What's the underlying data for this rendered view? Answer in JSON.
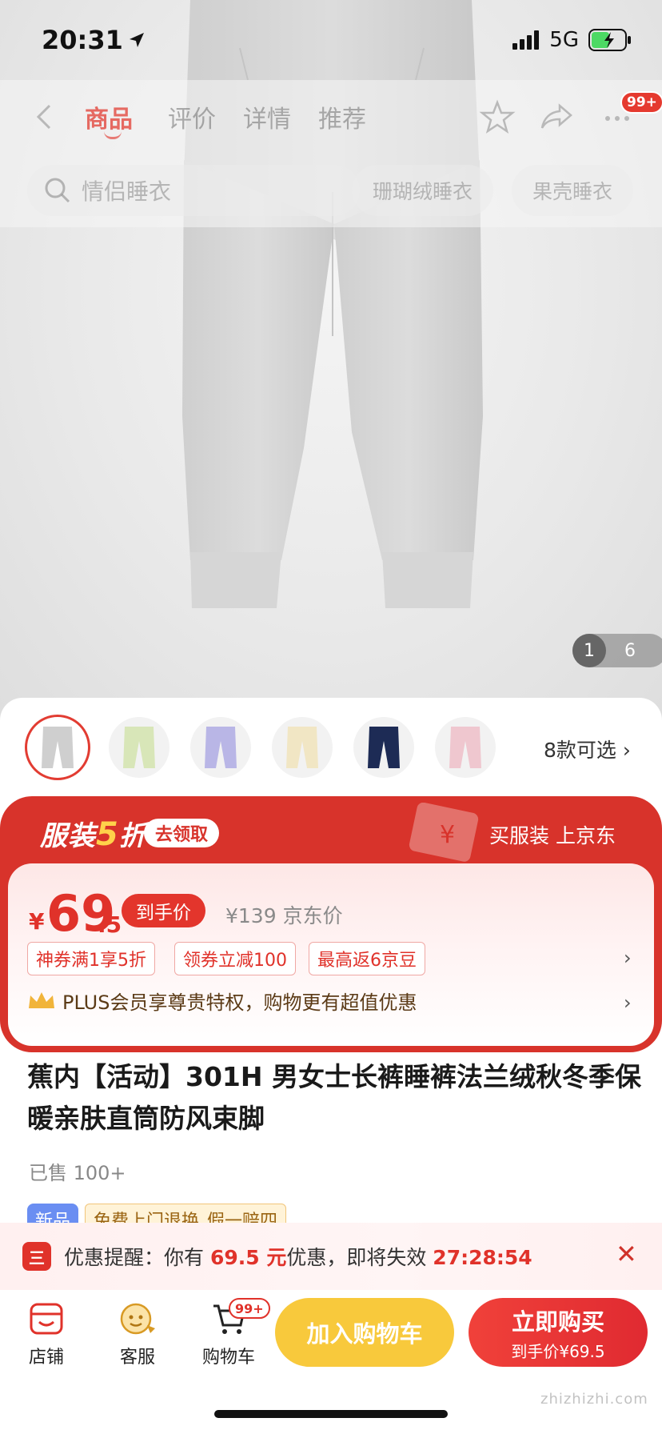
{
  "status": {
    "time": "20:31",
    "network": "5G"
  },
  "nav": {
    "tabs": [
      "商品",
      "评价",
      "详情",
      "推荐"
    ],
    "active_tab": "商品",
    "message_badge": "99+"
  },
  "search": {
    "placeholder": "情侣睡衣",
    "chips": [
      "珊瑚绒睡衣",
      "果壳睡衣"
    ]
  },
  "gallery": {
    "current": "1",
    "total": "6"
  },
  "variants": {
    "colors": [
      "#cfcfcf",
      "#d8e6b8",
      "#b9b6e6",
      "#f1e6c4",
      "#1d2b55",
      "#efc7cf"
    ],
    "more_label": "8款可选 ›"
  },
  "promo": {
    "title_prefix": "服装",
    "title_five": "5",
    "title_suffix": "折",
    "claim_label": "去领取",
    "slogan": "买服装 上京东",
    "ticket_symbol": "¥"
  },
  "price": {
    "currency": "¥",
    "integer": "69",
    "decimal": ".5",
    "net_label": "到手价",
    "original": "¥139 京东价",
    "coupons": [
      "神券满1享5折",
      "领券立减100",
      "最高返6京豆"
    ],
    "plus_text": "PLUS会员享尊贵特权，购物更有超值优惠",
    "arrow": "›"
  },
  "product": {
    "title": "蕉内【活动】301H 男女士长裤睡裤法兰绒秋冬季保暖亲肤直筒防风束脚",
    "sold": "已售 100+",
    "tag_new": "新品",
    "tag_service_1": "免费上门退换",
    "tag_service_2": "假一赔四"
  },
  "reminder": {
    "icon_text": "三",
    "label": "优惠提醒：你有 ",
    "amount": "69.5 元",
    "middle": "优惠，即将失效 ",
    "countdown": "27:28:54",
    "close": "✕"
  },
  "bottom": {
    "store": "店铺",
    "service": "客服",
    "cart": "购物车",
    "cart_badge": "99+",
    "add_cart": "加入购物车",
    "buy_now": "立即购买",
    "buy_now_sub": "到手价¥69.5"
  },
  "watermark": "zhizhizhi.com"
}
